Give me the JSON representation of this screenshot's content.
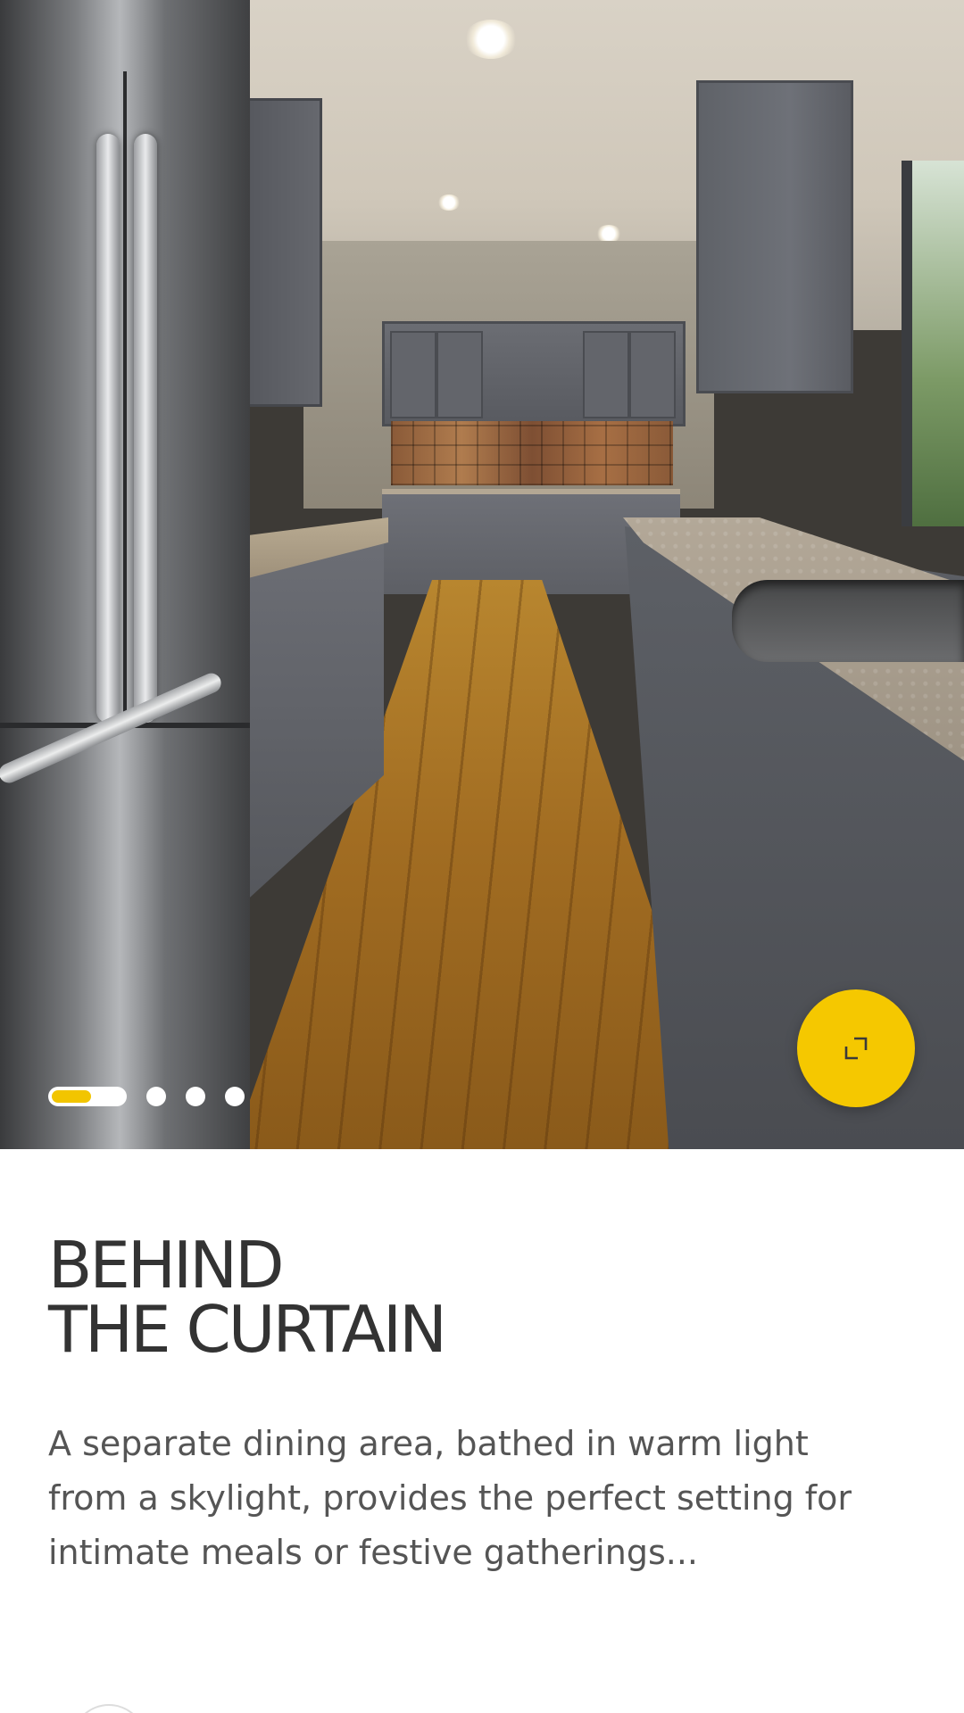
{
  "hero": {
    "image_description": "",
    "carousel": {
      "total_slides": 4,
      "active_index": 0,
      "active_progress": 0.55,
      "indicator_color": "#f2c500"
    },
    "expand_button": {
      "icon": "expand-icon",
      "color": "#f5c800"
    }
  },
  "content": {
    "title_line_1": "BEHIND",
    "title_line_2": "THE CURTAIN",
    "description": "A separate dining area, bathed in warm light from a skylight, provides the perfect setting for intimate meals or festive gatherings..."
  }
}
